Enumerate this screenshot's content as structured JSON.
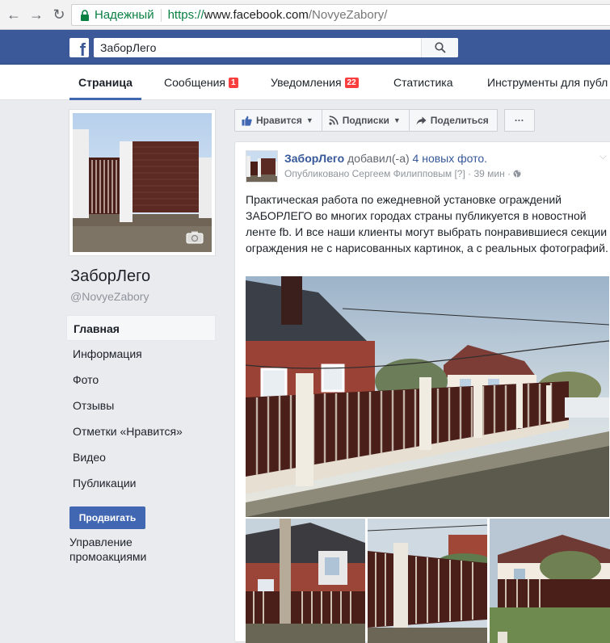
{
  "browser": {
    "secure_label": "Надежный",
    "url_protocol": "https://",
    "url_host": "www.facebook.com",
    "url_path": "/NovyeZabory/"
  },
  "fb_bar": {
    "logo": "f",
    "search_value": "ЗаборЛего"
  },
  "tabs": {
    "page": "Страница",
    "messages": "Сообщения",
    "messages_badge": "1",
    "notifications": "Уведомления",
    "notifications_badge": "22",
    "insights": "Статистика",
    "publishing_tools": "Инструменты для публ"
  },
  "page": {
    "name": "ЗаборЛего",
    "handle": "@NovyeZabory"
  },
  "left_nav": {
    "items": [
      "Главная",
      "Информация",
      "Фото",
      "Отзывы",
      "Отметки «Нравится»",
      "Видео",
      "Публикации"
    ],
    "promote_button": "Продвигать",
    "manage_promotions": "Управление промоакциями"
  },
  "actions": {
    "like": "Нравится",
    "follow": "Подписки",
    "share": "Поделиться",
    "more": "···"
  },
  "post": {
    "author": "ЗаборЛего",
    "verb": "добавил(-а)",
    "photos_link": "4 новых фото.",
    "published_by": "Опубликовано Сергеем Филипповым",
    "help_marker": "[?]",
    "time": "· 39 мин ·",
    "chevron": "⌵",
    "text": "Практическая работа по ежедневной установке ограждений ЗАБОРЛЕГО во многих городах страны публикуется в новостной ленте fb. И все наши клиенты могут выбрать понравившиеся секции ограждения не с нарисованных картинок, а с реальных фотографий."
  },
  "colors": {
    "fb_blue": "#3b5998",
    "link_blue": "#365899",
    "badge_red": "#fa3e3e",
    "secure_green": "#0b8043",
    "fence_brown": "#4a1f1a"
  }
}
